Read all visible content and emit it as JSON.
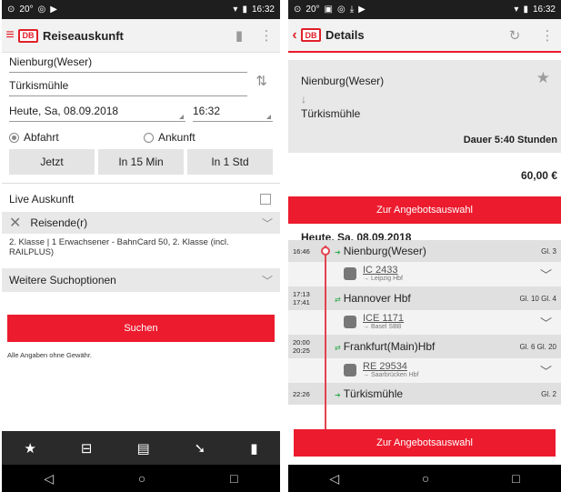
{
  "left": {
    "status": {
      "left": "20°",
      "time": "16:32"
    },
    "appbar": {
      "title": "Reiseauskunft",
      "logo": "DB"
    },
    "search": {
      "from": "Nienburg(Weser)",
      "to": "Türkismühle",
      "date": "Heute, Sa, 08.09.2018",
      "time": "16:32",
      "departure_label": "Abfahrt",
      "arrival_label": "Ankunft",
      "time_buttons": [
        "Jetzt",
        "In 15 Min",
        "In 1 Std"
      ]
    },
    "live_label": "Live Auskunft",
    "travellers_label": "Reisende(r)",
    "travellers_desc": "2. Klasse  |  1 Erwachsener - BahnCard 50, 2. Klasse (incl. RAILPLUS)",
    "more_options_label": "Weitere Suchoptionen",
    "search_button": "Suchen",
    "disclaimer": "Alle Angaben ohne Gewähr."
  },
  "right": {
    "status": {
      "left": "20°",
      "time": "16:32"
    },
    "appbar": {
      "title": "Details",
      "logo": "DB"
    },
    "route": {
      "from": "Nienburg(Weser)",
      "to": "Türkismühle",
      "duration": "Dauer 5:40 Stunden"
    },
    "price": "60,00 €",
    "offer_button": "Zur Angebotsauswahl",
    "date": "Heute, Sa, 08.09.2018",
    "stops": [
      {
        "times": "16:46",
        "name": "Nienburg(Weser)",
        "track": "Gl. 3"
      },
      {
        "times": "17:13 17:41",
        "name": "Hannover Hbf",
        "track": "Gl. 10 Gl. 4"
      },
      {
        "times": "20:00 20:25",
        "name": "Frankfurt(Main)Hbf",
        "track": "Gl. 6 Gl. 20"
      },
      {
        "times": "22:26",
        "name": "Türkismühle",
        "track": "Gl. 2"
      }
    ],
    "legs": [
      {
        "train": "IC 2433",
        "direction": "→ Leipzig Hbf"
      },
      {
        "train": "ICE 1171",
        "direction": "→ Basel SBB"
      },
      {
        "train": "RE 29534",
        "direction": "→ Saarbrücken Hbf"
      }
    ],
    "offer_button_bottom": "Zur Angebotsauswahl"
  },
  "colors": {
    "accent": "#ec1b2e",
    "timeline": "#e3434e"
  }
}
